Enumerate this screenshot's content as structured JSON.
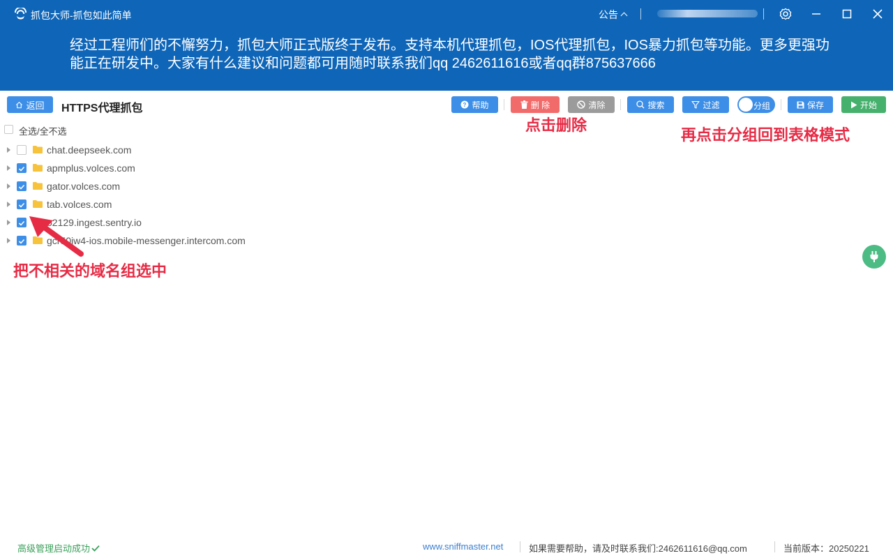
{
  "app": {
    "title": "抓包大师-抓包如此简单",
    "notice_label": "公告"
  },
  "announcement": "经过工程师们的不懈努力，抓包大师正式版终于发布。支持本机代理抓包，IOS代理抓包，IOS暴力抓包等功能。更多更强功能正在研发中。大家有什么建议和问题都可用随时联系我们qq 2462611616或者qq群875637666",
  "toolbar": {
    "back_label": "返回",
    "page_title": "HTTPS代理抓包",
    "help_label": "帮助",
    "delete_label": "删 除",
    "clear_label": "清除",
    "search_label": "搜索",
    "filter_label": "过滤",
    "group_label": "分组",
    "save_label": "保存",
    "start_label": "开始"
  },
  "select_all_label": "全选/全不选",
  "domains": [
    {
      "name": "chat.deepseek.com",
      "checked": false
    },
    {
      "name": "apmplus.volces.com",
      "checked": true
    },
    {
      "name": "gator.volces.com",
      "checked": true
    },
    {
      "name": "tab.volces.com",
      "checked": true
    },
    {
      "name": "o2129.ingest.sentry.io",
      "checked": true
    },
    {
      "name": "gcr50jw4-ios.mobile-messenger.intercom.com",
      "checked": true
    }
  ],
  "annotations": {
    "delete_hint": "点击删除",
    "group_hint": "再点击分组回到表格模式",
    "select_hint": "把不相关的域名组选中"
  },
  "footer": {
    "status": "高级管理启动成功",
    "site": "www.sniffmaster.net",
    "help": "如果需要帮助，请及时联系我们:2462611616@qq.com",
    "version": "当前版本：20250221"
  },
  "colors": {
    "header_blue": "#0f66b8",
    "primary": "#3d8ee6",
    "danger": "#f26b6b",
    "neutral": "#9b9b9b",
    "success": "#46b06d",
    "annotation": "#e62b45"
  }
}
